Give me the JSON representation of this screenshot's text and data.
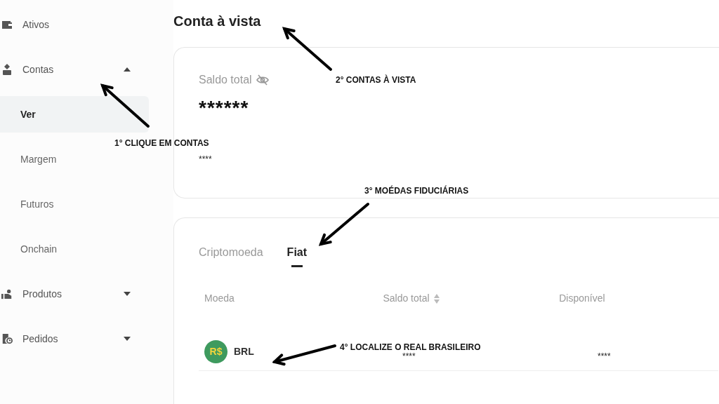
{
  "sidebar": {
    "items": [
      {
        "kind": "group",
        "label": "Ativos"
      },
      {
        "kind": "group",
        "label": "Contas",
        "expanded": true
      },
      {
        "kind": "subitem",
        "label": "Ver",
        "selected": true
      },
      {
        "kind": "subitem",
        "label": "Margem",
        "selected": false
      },
      {
        "kind": "subitem",
        "label": "Futuros",
        "selected": false
      },
      {
        "kind": "subitem",
        "label": "Onchain",
        "selected": false
      },
      {
        "kind": "group",
        "label": "Produtos",
        "expanded": false
      },
      {
        "kind": "group",
        "label": "Pedidos",
        "expanded": false
      }
    ]
  },
  "page_title": "Conta à vista",
  "balance_card": {
    "label": "Saldo total",
    "hidden": true,
    "value": "******",
    "secondary_value": "****"
  },
  "tabs": [
    {
      "label": "Criptomoeda",
      "selected": false
    },
    {
      "label": "Fiat",
      "selected": true
    }
  ],
  "table": {
    "columns": [
      {
        "label": "Moeda"
      },
      {
        "label": "Saldo total",
        "sortable": true
      },
      {
        "label": "Disponível"
      }
    ],
    "rows": [
      {
        "symbol": "R$",
        "currency": "BRL",
        "total": "****",
        "available": "****"
      }
    ]
  },
  "annotations": [
    {
      "text": "1° CLIQUE EM CONTAS"
    },
    {
      "text": "2° CONTAS À VISTA"
    },
    {
      "text": "3° MOÉDAS FIDUCIÁRIAS"
    },
    {
      "text": "4° LOCALIZE O REAL BRASILEIRO"
    }
  ]
}
